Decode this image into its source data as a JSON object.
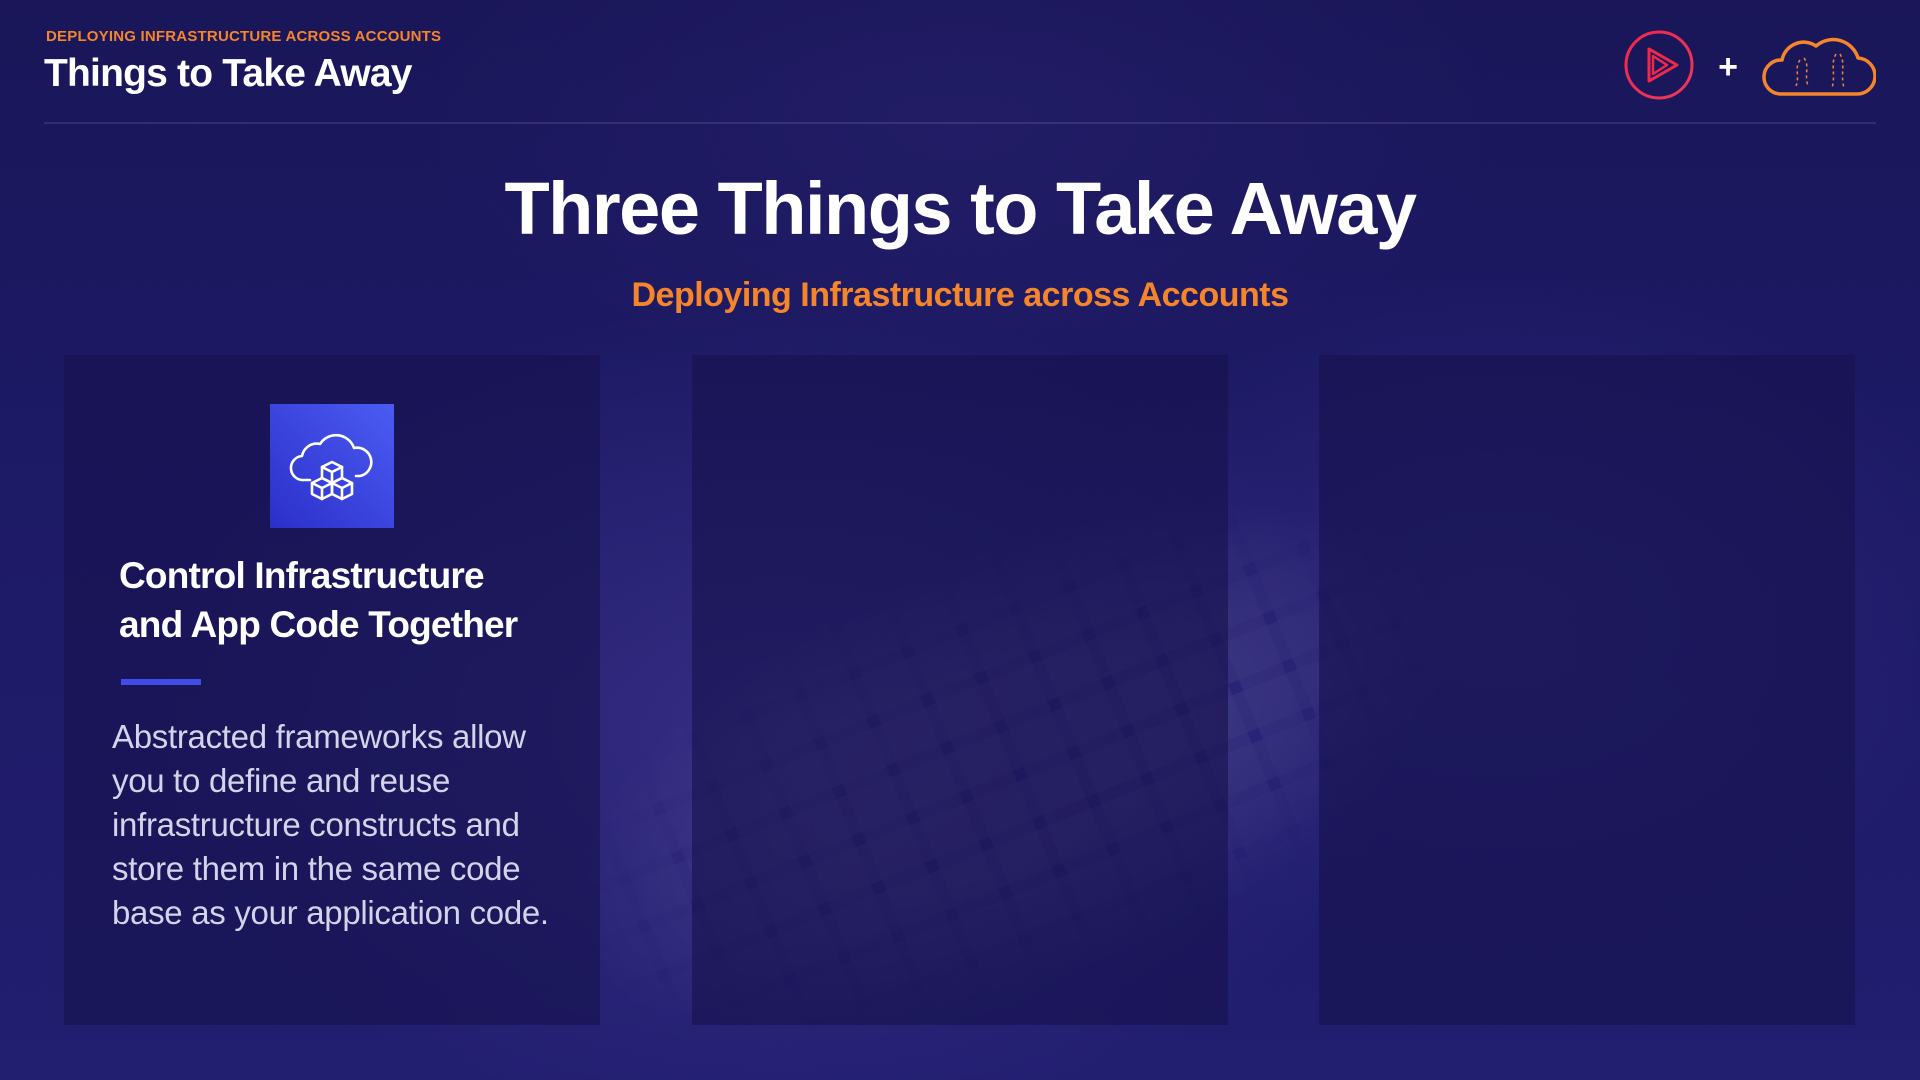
{
  "header": {
    "kicker": "DEPLOYING INFRASTRUCTURE ACROSS ACCOUNTS",
    "title": "Things to Take Away",
    "brand": {
      "logo_icon": "pluralsight-play-icon",
      "plus": "+",
      "partner_icon": "cloud-icon"
    }
  },
  "slide": {
    "title": "Three Things to Take Away",
    "subtitle": "Deploying Infrastructure across Accounts"
  },
  "cards": [
    {
      "icon": "cloud-cubes-icon",
      "title_line1": "Control Infrastructure",
      "title_line2": "and App Code Together",
      "body": "Abstracted frameworks allow you to define and reuse infrastructure constructs and store them in the same code base as your application code."
    },
    {},
    {}
  ],
  "colors": {
    "accent_orange": "#f5852b",
    "background": "#1d1a66",
    "icon_blue": "#3d4de6",
    "brand_pink": "#e8395d"
  }
}
